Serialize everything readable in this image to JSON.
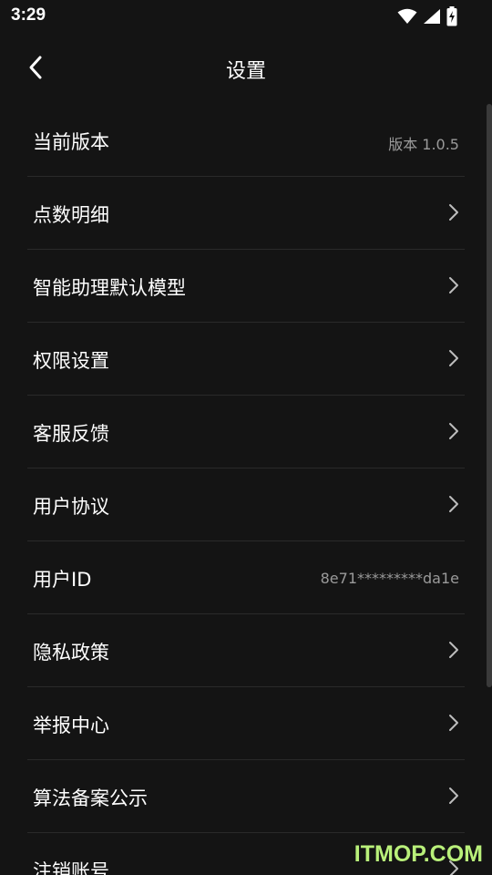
{
  "status_bar": {
    "time": "3:29",
    "icons": [
      "wifi-icon",
      "signal-icon",
      "battery-charging-icon"
    ]
  },
  "header": {
    "title": "设置",
    "back_icon": "chevron-left-icon"
  },
  "settings": {
    "items": [
      {
        "label": "当前版本",
        "value": "版本 1.0.5",
        "chevron": false
      },
      {
        "label": "点数明细",
        "value": "",
        "chevron": true
      },
      {
        "label": "智能助理默认模型",
        "value": "",
        "chevron": true
      },
      {
        "label": "权限设置",
        "value": "",
        "chevron": true
      },
      {
        "label": "客服反馈",
        "value": "",
        "chevron": true
      },
      {
        "label": "用户协议",
        "value": "",
        "chevron": true
      },
      {
        "label": "用户ID",
        "value": "8e71*********da1e",
        "chevron": false
      },
      {
        "label": "隐私政策",
        "value": "",
        "chevron": true
      },
      {
        "label": "举报中心",
        "value": "",
        "chevron": true
      },
      {
        "label": "算法备案公示",
        "value": "",
        "chevron": true
      },
      {
        "label": "注销账号",
        "value": "",
        "chevron": true
      }
    ]
  },
  "watermark": {
    "text": "ITMOP.COM"
  },
  "colors": {
    "background": "#141414",
    "text": "#ffffff",
    "secondary_text": "#9a9a9a",
    "divider": "#2a2a2a",
    "watermark": "#b9f07a"
  }
}
